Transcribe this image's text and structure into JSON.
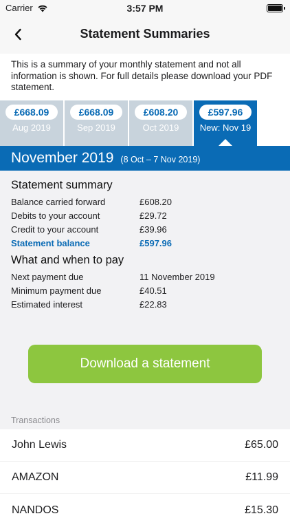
{
  "status_bar": {
    "carrier": "Carrier",
    "time": "3:57 PM"
  },
  "nav": {
    "title": "Statement Summaries"
  },
  "intro_text": "This is a summary of your monthly statement and not all information is shown. For full details please download your PDF statement.",
  "tabs": [
    {
      "amount": "£668.09",
      "label": "Aug 2019",
      "active": false
    },
    {
      "amount": "£668.09",
      "label": "Sep 2019",
      "active": false
    },
    {
      "amount": "£608.20",
      "label": "Oct 2019",
      "active": false
    },
    {
      "amount": "£597.96",
      "label": "New: Nov 19",
      "active": true
    }
  ],
  "month_header": {
    "title": "November 2019",
    "range": "(8 Oct – 7 Nov 2019)"
  },
  "statement_summary": {
    "heading": "Statement summary",
    "rows": [
      {
        "label": "Balance carried forward",
        "value": "£608.20"
      },
      {
        "label": "Debits to your account",
        "value": "£29.72"
      },
      {
        "label": "Credit to your account",
        "value": "£39.96"
      },
      {
        "label": "Statement balance",
        "value": "£597.96"
      }
    ]
  },
  "what_to_pay": {
    "heading": "What and when to pay",
    "rows": [
      {
        "label": "Next payment due",
        "value": "11 November 2019"
      },
      {
        "label": "Minimum payment due",
        "value": "£40.51"
      },
      {
        "label": "Estimated interest",
        "value": "£22.83"
      }
    ]
  },
  "download_button": "Download a statement",
  "transactions": {
    "header": "Transactions",
    "items": [
      {
        "merchant": "John Lewis",
        "amount": "£65.00"
      },
      {
        "merchant": "AMAZON",
        "amount": "£11.99"
      },
      {
        "merchant": "NANDOS",
        "amount": "£15.30"
      }
    ]
  },
  "colors": {
    "primary": "#0a6bb5",
    "tab_inactive": "#c8d3dc",
    "button_green": "#8dc63f"
  }
}
